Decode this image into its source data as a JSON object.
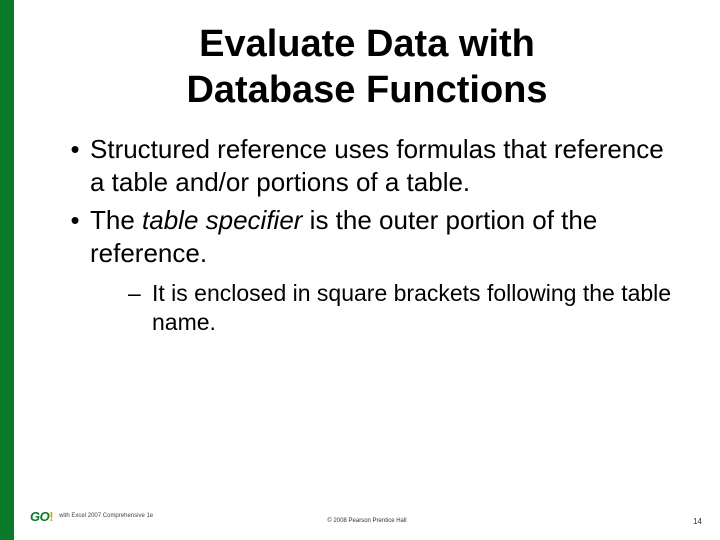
{
  "title_line1": "Evaluate Data with",
  "title_line2": "Database Functions",
  "bullets": {
    "b1": "Structured reference uses formulas that reference a table and/or portions of a table.",
    "b2_pre": "The ",
    "b2_em": "table specifier",
    "b2_post": " is the outer portion of the reference.",
    "b2_sub1": "It is enclosed in square brackets following the table name."
  },
  "footer": {
    "logo_text": "GO",
    "logo_excl": "!",
    "brand_sub": "with Excel 2007 Comprehensive 1e",
    "copyright": "© 2008 Pearson Prentice Hall",
    "page": "14"
  }
}
